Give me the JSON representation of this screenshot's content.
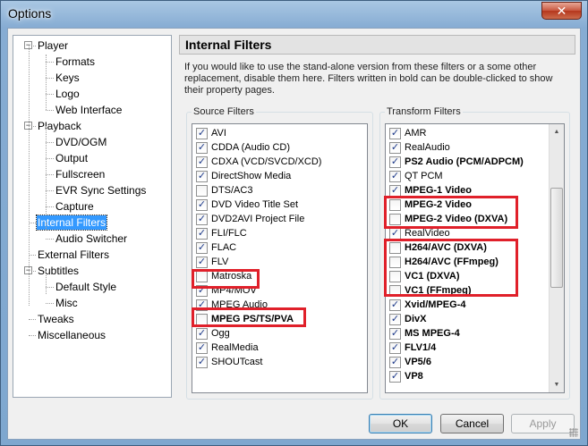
{
  "window": {
    "title": "Options",
    "close_glyph": "✕"
  },
  "tree": {
    "items": [
      {
        "label": "Player",
        "expander": "−"
      },
      {
        "label": "Formats"
      },
      {
        "label": "Keys"
      },
      {
        "label": "Logo"
      },
      {
        "label": "Web Interface"
      },
      {
        "label": "Playback",
        "expander": "−"
      },
      {
        "label": "DVD/OGM"
      },
      {
        "label": "Output"
      },
      {
        "label": "Fullscreen"
      },
      {
        "label": "EVR Sync Settings"
      },
      {
        "label": "Capture"
      },
      {
        "label": "Internal Filters",
        "selected": true
      },
      {
        "label": "Audio Switcher"
      },
      {
        "label": "External Filters"
      },
      {
        "label": "Subtitles",
        "expander": "−"
      },
      {
        "label": "Default Style"
      },
      {
        "label": "Misc"
      },
      {
        "label": "Tweaks"
      },
      {
        "label": "Miscellaneous"
      }
    ]
  },
  "panel": {
    "title": "Internal Filters",
    "description": "If you would like to use the stand-alone version from these filters or a some other replacement, disable them here. Filters written in bold can be double-clicked to show their property pages."
  },
  "source_filters": {
    "label": "Source Filters",
    "items": [
      {
        "label": "AVI",
        "checked": true
      },
      {
        "label": "CDDA (Audio CD)",
        "checked": true
      },
      {
        "label": "CDXA (VCD/SVCD/XCD)",
        "checked": true
      },
      {
        "label": "DirectShow Media",
        "checked": true
      },
      {
        "label": "DTS/AC3",
        "checked": false
      },
      {
        "label": "DVD Video Title Set",
        "checked": true
      },
      {
        "label": "DVD2AVI Project File",
        "checked": true
      },
      {
        "label": "FLI/FLC",
        "checked": true
      },
      {
        "label": "FLAC",
        "checked": true
      },
      {
        "label": "FLV",
        "checked": true
      },
      {
        "label": "Matroska",
        "checked": false
      },
      {
        "label": "MP4/MOV",
        "checked": true
      },
      {
        "label": "MPEG Audio",
        "checked": true
      },
      {
        "label": "MPEG PS/TS/PVA",
        "checked": false,
        "bold": true
      },
      {
        "label": "Ogg",
        "checked": true
      },
      {
        "label": "RealMedia",
        "checked": true
      },
      {
        "label": "SHOUTcast",
        "checked": true
      }
    ]
  },
  "transform_filters": {
    "label": "Transform Filters",
    "items": [
      {
        "label": "AMR",
        "checked": true
      },
      {
        "label": "RealAudio",
        "checked": true
      },
      {
        "label": "PS2 Audio (PCM/ADPCM)",
        "checked": true,
        "bold": true
      },
      {
        "label": "QT PCM",
        "checked": true
      },
      {
        "label": "MPEG-1 Video",
        "checked": true,
        "bold": true
      },
      {
        "label": "MPEG-2 Video",
        "checked": false,
        "bold": true
      },
      {
        "label": "MPEG-2 Video (DXVA)",
        "checked": false,
        "bold": true
      },
      {
        "label": "RealVideo",
        "checked": true
      },
      {
        "label": "H264/AVC (DXVA)",
        "checked": false,
        "bold": true
      },
      {
        "label": "H264/AVC (FFmpeg)",
        "checked": false,
        "bold": true
      },
      {
        "label": "VC1 (DXVA)",
        "checked": false,
        "bold": true
      },
      {
        "label": "VC1 (FFmpeg)",
        "checked": false,
        "bold": true
      },
      {
        "label": "Xvid/MPEG-4",
        "checked": true,
        "bold": true
      },
      {
        "label": "DivX",
        "checked": true,
        "bold": true
      },
      {
        "label": "MS MPEG-4",
        "checked": true,
        "bold": true
      },
      {
        "label": "FLV1/4",
        "checked": true,
        "bold": true
      },
      {
        "label": "VP5/6",
        "checked": true,
        "bold": true
      },
      {
        "label": "VP8",
        "checked": true,
        "bold": true
      }
    ],
    "scroll_position": 0.35
  },
  "buttons": {
    "ok": "OK",
    "cancel": "Cancel",
    "apply": "Apply"
  },
  "colors": {
    "highlight": "#e0202a",
    "selection": "#3399ff"
  },
  "icons": {
    "check": "✓",
    "scroll_up": "▲",
    "scroll_down": "▼"
  }
}
